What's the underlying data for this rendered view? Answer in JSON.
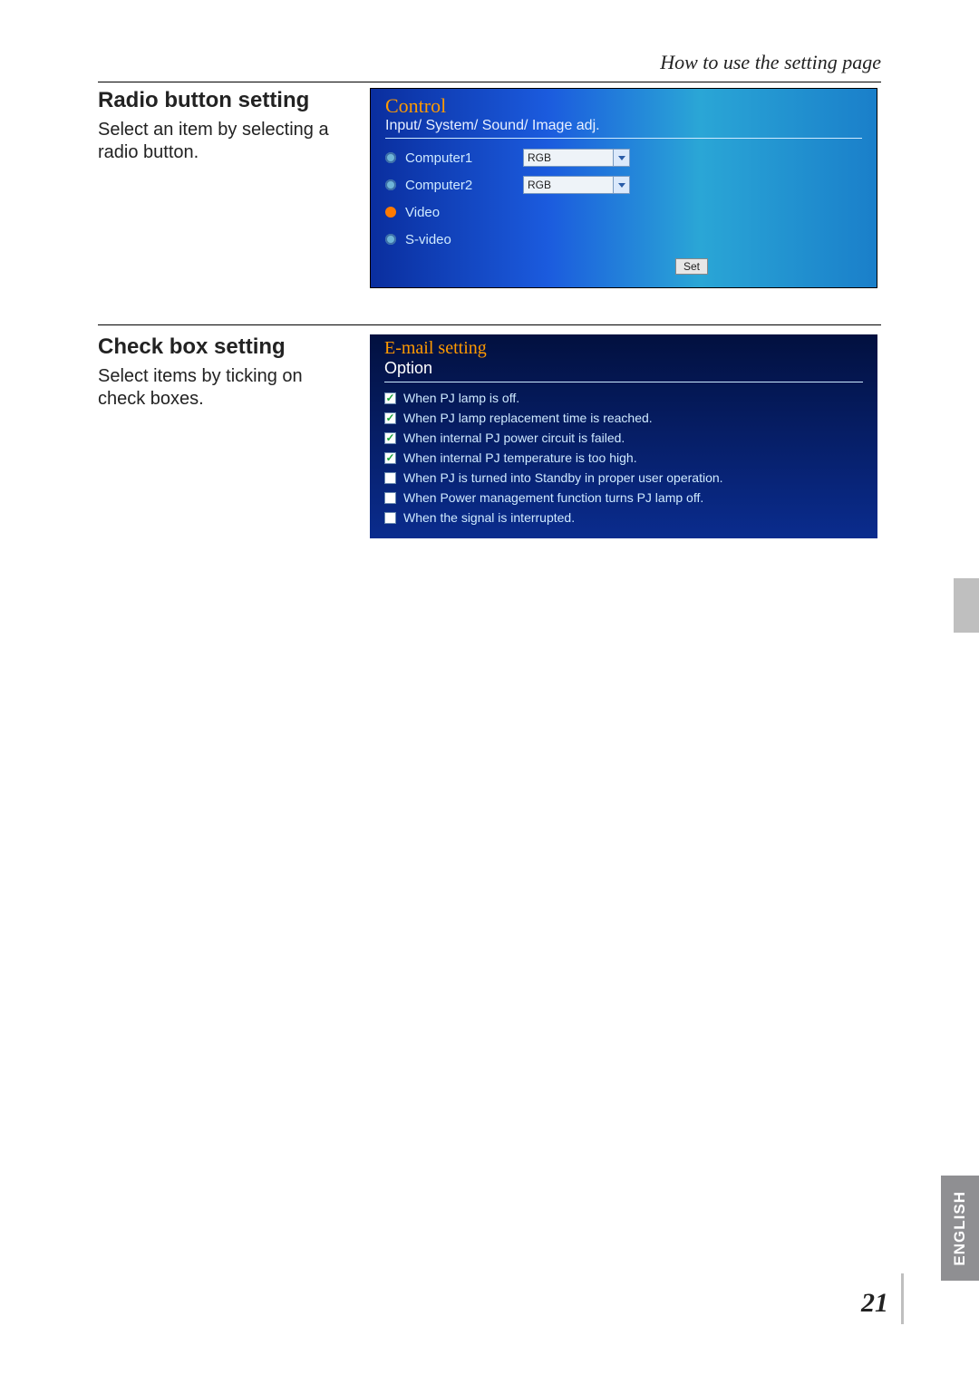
{
  "header": {
    "title": "How to use the setting page"
  },
  "sections": {
    "radio": {
      "heading": "Radio button setting",
      "desc": "Select an item by selecting a radio button.",
      "panel": {
        "title": "Control",
        "path": "Input/ System/ Sound/ Image adj.",
        "rows": [
          {
            "label": "Computer1",
            "selected": false,
            "select_value": "RGB"
          },
          {
            "label": "Computer2",
            "selected": false,
            "select_value": "RGB"
          },
          {
            "label": "Video",
            "selected": true
          },
          {
            "label": "S-video",
            "selected": false
          }
        ],
        "set_label": "Set"
      }
    },
    "checkbox": {
      "heading": "Check box setting",
      "desc": "Select items by ticking on check boxes.",
      "panel": {
        "title": "E-mail setting",
        "subtitle": "Option",
        "items": [
          {
            "checked": true,
            "label": "When PJ lamp is off."
          },
          {
            "checked": true,
            "label": "When PJ lamp replacement time is reached."
          },
          {
            "checked": true,
            "label": "When internal PJ power circuit is failed."
          },
          {
            "checked": true,
            "label": "When internal PJ temperature is too high."
          },
          {
            "checked": false,
            "label": "When PJ is turned into Standby in proper user operation."
          },
          {
            "checked": false,
            "label": "When Power management function turns PJ lamp off."
          },
          {
            "checked": false,
            "label": "When the signal is interrupted."
          }
        ]
      }
    }
  },
  "footer": {
    "language": "ENGLISH",
    "page_number": "21"
  }
}
